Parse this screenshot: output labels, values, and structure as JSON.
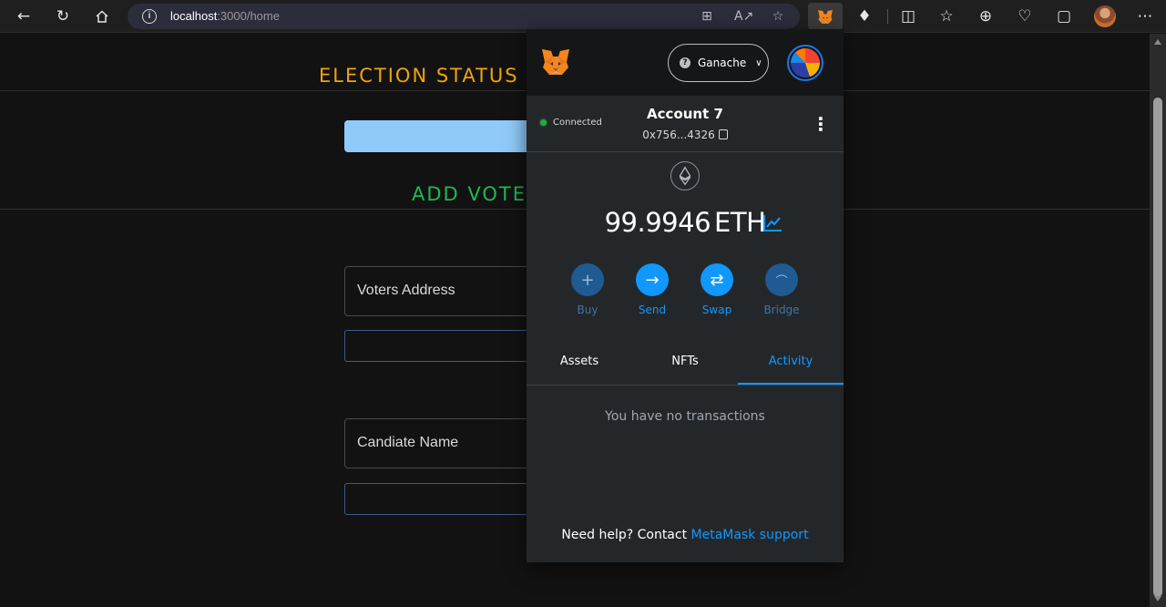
{
  "browser": {
    "url_host": "localhost",
    "url_path": ":3000/home"
  },
  "page": {
    "election_status_title": "ELECTION STATUS",
    "add_voter_title": "ADD VOTE",
    "voters_address_label": "Voters Address",
    "candidate_name_label": "Candiate Name",
    "colors": {
      "election_status_title": "#f0a30a",
      "add_voter_title": "#1db954",
      "primary_button": "#90caf9"
    }
  },
  "metamask": {
    "network": "Ganache",
    "status": "Connected",
    "account_name": "Account 7",
    "account_address": "0x756...4326",
    "balance": "99.9946",
    "currency": "ETH",
    "actions": [
      {
        "label": "Buy",
        "icon": "plus-icon"
      },
      {
        "label": "Send",
        "icon": "arrow-right-icon"
      },
      {
        "label": "Swap",
        "icon": "swap-icon"
      },
      {
        "label": "Bridge",
        "icon": "bridge-icon"
      }
    ],
    "tabs": [
      "Assets",
      "NFTs",
      "Activity"
    ],
    "active_tab": "Activity",
    "empty_message": "You have no transactions",
    "help_text": "Need help? Contact",
    "help_link": "MetaMask support",
    "colors": {
      "accent": "#1098fc",
      "header": "#141618",
      "body": "#24272a"
    }
  }
}
